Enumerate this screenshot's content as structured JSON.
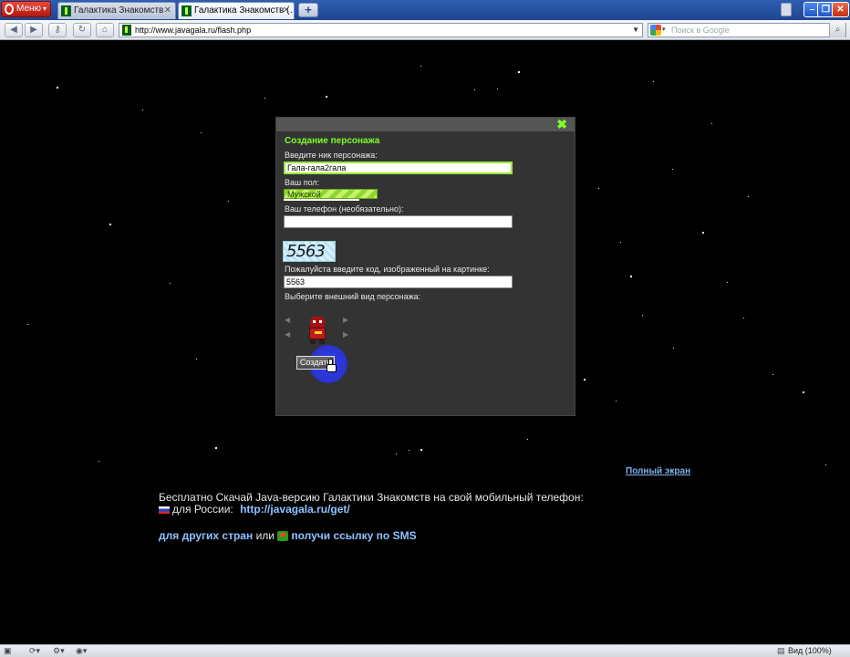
{
  "browser": {
    "menu_label": "Меню",
    "tabs": [
      {
        "title": "Галактика Знакомств",
        "active": false
      },
      {
        "title": "Галактика Знакомств (…",
        "active": true
      }
    ],
    "new_tab_label": "+",
    "url": "http://www.javagala.ru/flash.php",
    "search_placeholder": "Поиск в Google",
    "window_buttons": {
      "minimize": "–",
      "maximize": "❐",
      "close": "✕"
    }
  },
  "dialog": {
    "title": "Создание персонажа",
    "nick_label": "Введите ник персонажа:",
    "nick_value": "Гала-гала2гала",
    "gender_label": "Ваш пол:",
    "gender_value": "Мужской",
    "phone_label": "Ваш телефон (необязательно):",
    "phone_value": "",
    "captcha_text": "5563",
    "code_label": "Пожалуйста введите код, изображенный на картинке:",
    "code_value": "5563",
    "appearance_label": "Выберите внешний вид персонажа:",
    "create_button": "Создать",
    "close_icon": "✖"
  },
  "page": {
    "fullscreen_link": "Полный экран",
    "promo_line1": "Бесплатно Скачай Java-версию Галактики Знакомств на свой мобильный телефон:",
    "promo_russia_prefix": "для России:",
    "promo_russia_link": "http://javagala.ru/get/",
    "promo_other_link": "для других стран",
    "promo_or": "или",
    "promo_sms_link": "получи ссылку по SMS"
  },
  "statusbar": {
    "zoom_label": "Вид (100%)"
  },
  "colors": {
    "accent_green": "#7dff29",
    "link_blue": "#8ec2ff",
    "highlight_blue": "#2b35d8"
  }
}
